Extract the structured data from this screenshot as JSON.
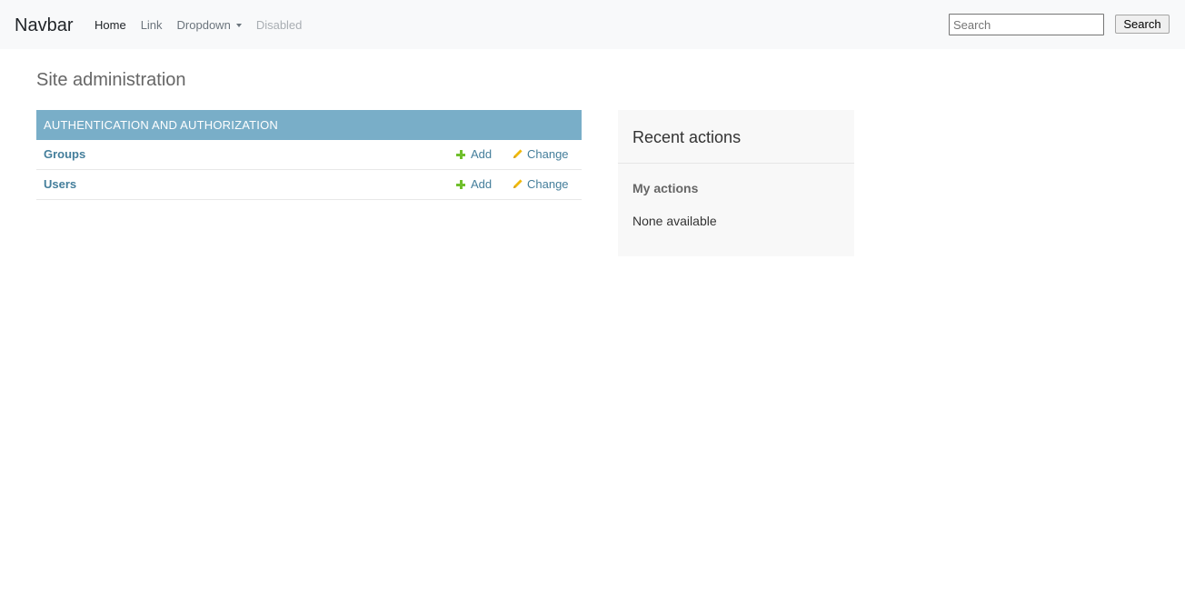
{
  "navbar": {
    "brand": "Navbar",
    "links": [
      {
        "label": "Home",
        "state": "active"
      },
      {
        "label": "Link",
        "state": "normal"
      },
      {
        "label": "Dropdown",
        "state": "normal"
      },
      {
        "label": "Disabled",
        "state": "disabled"
      }
    ],
    "search": {
      "placeholder": "Search",
      "value": "",
      "button_label": "Search"
    }
  },
  "page": {
    "title": "Site administration"
  },
  "app_module": {
    "caption": "Authentication and Authorization",
    "rows": [
      {
        "name": "Groups",
        "add_label": "Add",
        "change_label": "Change"
      },
      {
        "name": "Users",
        "add_label": "Add",
        "change_label": "Change"
      }
    ]
  },
  "recent_actions": {
    "title": "Recent actions",
    "subtitle": "My actions",
    "empty_text": "None available"
  },
  "colors": {
    "navbar_bg": "#f8f9fa",
    "module_header": "#79aec8",
    "link": "#447e9b",
    "add_icon": "#70bf2b",
    "change_icon": "#efb80b",
    "recent_bg": "#f8f8f8"
  },
  "icons": {
    "add": "plus-icon",
    "change": "pencil-icon",
    "dropdown": "caret-down-icon"
  }
}
